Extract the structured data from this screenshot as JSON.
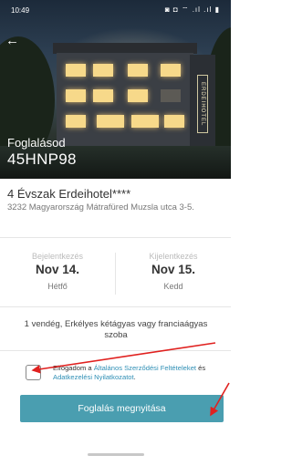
{
  "status_bar": {
    "time": "10:49",
    "icons": "◙ ◘ ⌔ .ıl .ıl ▮"
  },
  "header": {
    "back_icon": "arrow-left-icon",
    "label": "Foglalásod",
    "booking_code": "45HNP98",
    "hotel_sign": "ERDEIHOTEL"
  },
  "hotel": {
    "name": "4 Évszak Erdeihotel****",
    "address": "3232 Magyarország Mátrafüred Muzsla utca 3-5."
  },
  "dates": {
    "checkin_label": "Bejelentkezés",
    "checkin_day": "Nov 14.",
    "checkin_weekday": "Hétfő",
    "checkout_label": "Kijelentkezés",
    "checkout_day": "Nov 15.",
    "checkout_weekday": "Kedd"
  },
  "room": {
    "description": "1 vendég, Erkélyes kétágyas vagy franciaágyas szoba"
  },
  "terms": {
    "checked": false,
    "prefix": "Elfogadom a ",
    "link1": "Általános Szerződési Feltételeket",
    "middle": " és ",
    "link2": "Adatkezelési Nyilatkozatot",
    "suffix": "."
  },
  "cta": {
    "label": "Foglalás megnyitása"
  },
  "colors": {
    "accent": "#4a9eb0",
    "link": "#2f8fb5",
    "annotation": "#e0211f"
  }
}
